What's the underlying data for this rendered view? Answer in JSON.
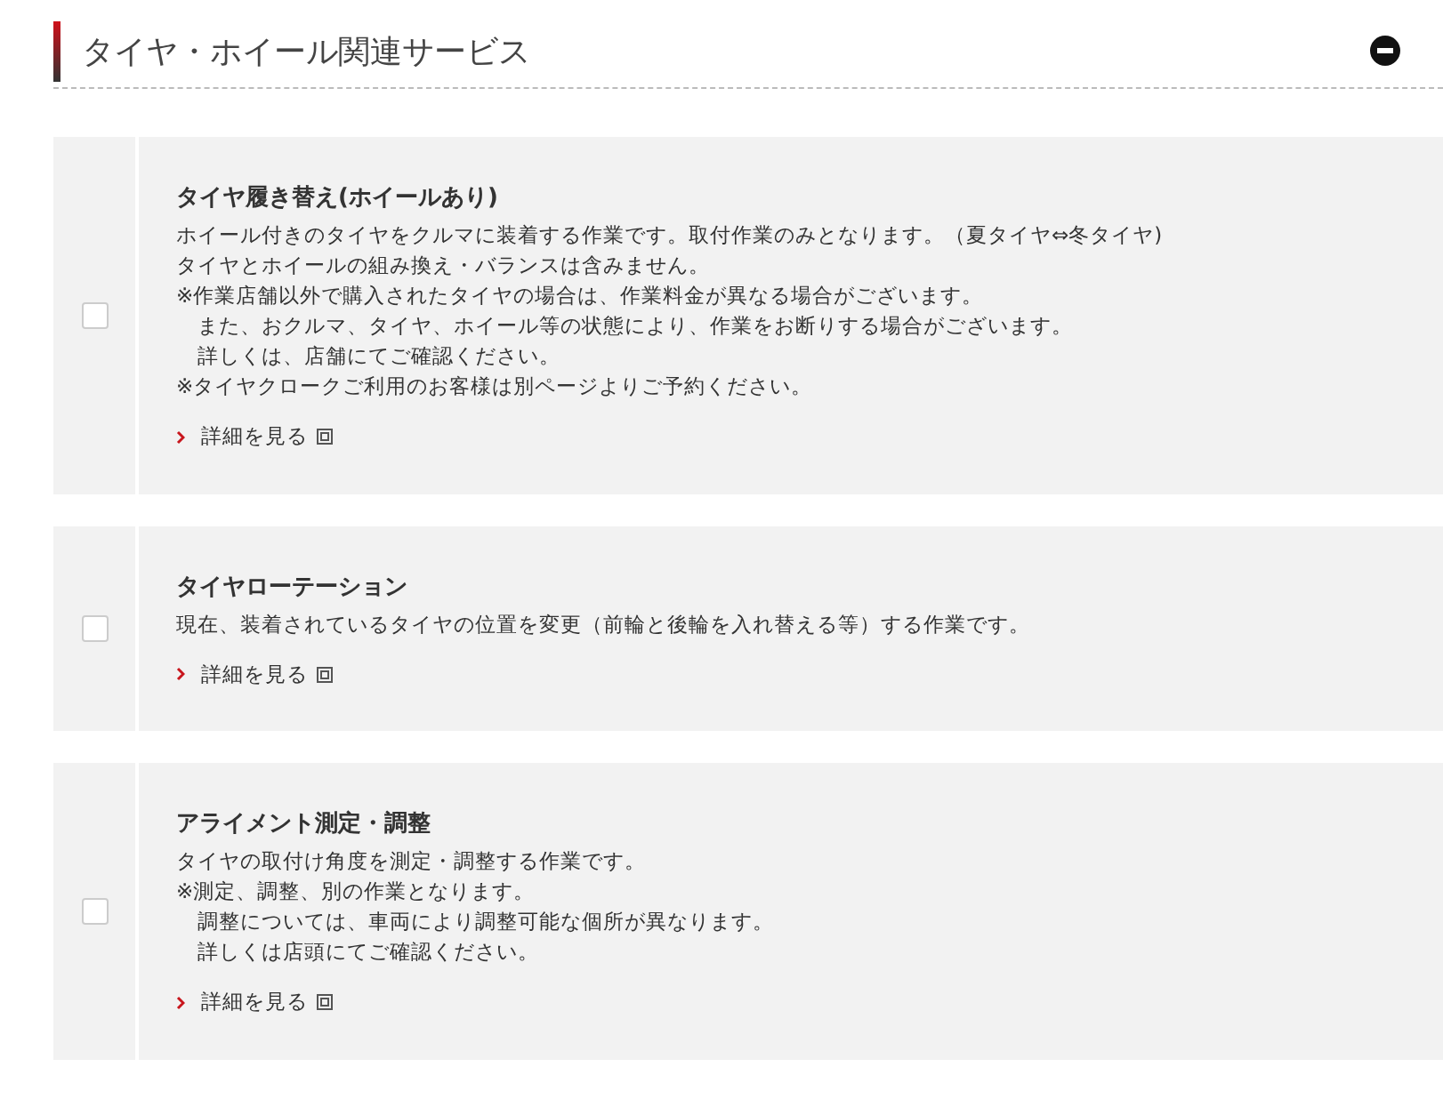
{
  "section": {
    "title": "タイヤ・ホイール関連サービス",
    "expanded": true
  },
  "services": [
    {
      "checked": false,
      "title": "タイヤ履き替え(ホイールあり)",
      "lines": [
        {
          "text": "ホイール付きのタイヤをクルマに装着する作業です。取付作業のみとなります。（夏タイヤ⇔冬タイヤ)",
          "indent": false
        },
        {
          "text": "タイヤとホイールの組み換え・バランスは含みません。",
          "indent": false
        },
        {
          "text": "※作業店舗以外で購入されたタイヤの場合は、作業料金が異なる場合がございます。",
          "indent": false
        },
        {
          "text": "また、おクルマ、タイヤ、ホイール等の状態により、作業をお断りする場合がございます。",
          "indent": true
        },
        {
          "text": "詳しくは、店舗にてご確認ください。",
          "indent": true
        },
        {
          "text": "※タイヤクロークご利用のお客様は別ページよりご予約ください。",
          "indent": false
        }
      ],
      "link": "詳細を見る"
    },
    {
      "checked": false,
      "title": "タイヤローテーション",
      "lines": [
        {
          "text": "現在、装着されているタイヤの位置を変更（前輪と後輪を入れ替える等）する作業です。",
          "indent": false
        }
      ],
      "link": "詳細を見る"
    },
    {
      "checked": false,
      "title": "アライメント測定・調整",
      "lines": [
        {
          "text": "タイヤの取付け角度を測定・調整する作業です。",
          "indent": false
        },
        {
          "text": "※測定、調整、別の作業となります。",
          "indent": false
        },
        {
          "text": "調整については、車両により調整可能な個所が異なります。",
          "indent": true
        },
        {
          "text": "詳しくは店頭にてご確認ください。",
          "indent": true
        }
      ],
      "link": "詳細を見る"
    }
  ]
}
